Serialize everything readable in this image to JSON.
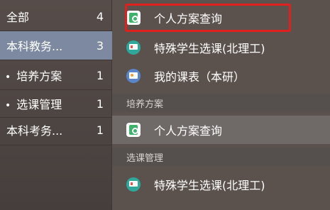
{
  "sidebar": {
    "items": [
      {
        "label": "全部",
        "count": "4"
      },
      {
        "label": "本科教务...",
        "count": "3"
      },
      {
        "label": "培养方案",
        "count": "1"
      },
      {
        "label": "选课管理",
        "count": "1"
      },
      {
        "label": "本科考务...",
        "count": "1"
      }
    ]
  },
  "list": {
    "rows": [
      {
        "label": "个人方案查询",
        "icon": "plan-icon"
      },
      {
        "label": "特殊学生选课(北理工)",
        "icon": "special-course-icon"
      },
      {
        "label": "我的课表（本研）",
        "icon": "timetable-icon"
      }
    ],
    "sections": [
      {
        "title": "培养方案",
        "rows": [
          {
            "label": "个人方案查询",
            "icon": "plan-icon"
          }
        ]
      },
      {
        "title": "选课管理",
        "rows": [
          {
            "label": "特殊学生选课(北理工)",
            "icon": "special-course-icon"
          }
        ]
      }
    ]
  },
  "colors": {
    "sidebar_selected": "#7c89a0",
    "row_highlight": "#6f6a68",
    "red_box": "#e0201c"
  }
}
